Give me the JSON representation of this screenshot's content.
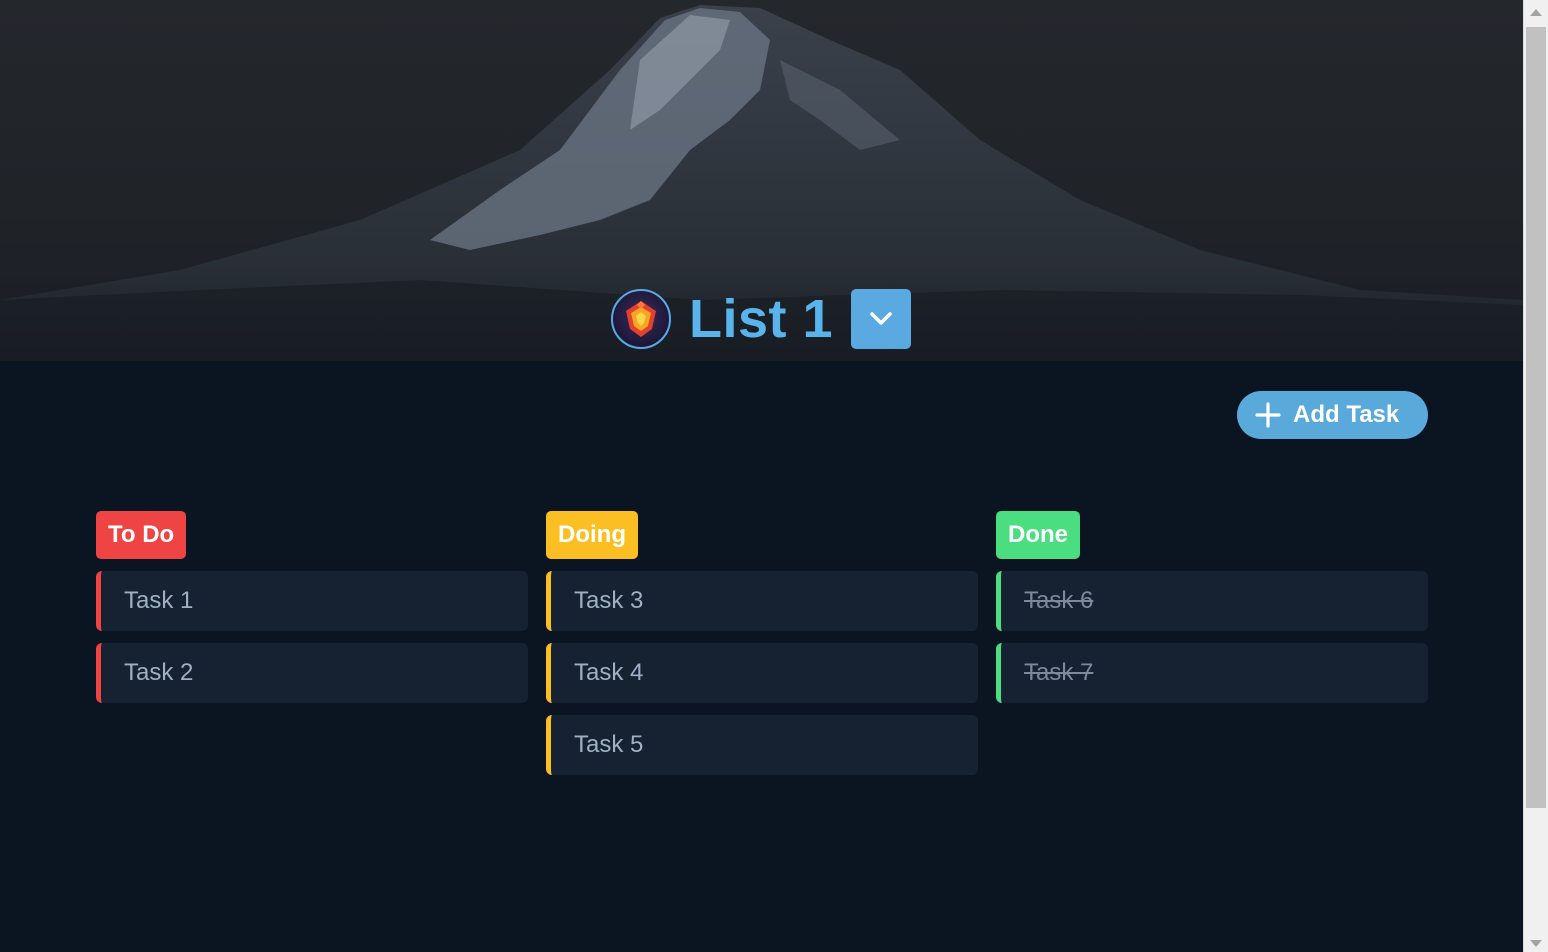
{
  "header": {
    "list_title": "List 1",
    "avatar_icon": "emblem-icon",
    "dropdown_icon": "chevron-down-icon"
  },
  "toolbar": {
    "add_task_label": "Add Task",
    "add_task_icon": "plus-icon"
  },
  "columns": [
    {
      "label": "To Do",
      "color": "#ef4444",
      "tasks": [
        "Task 1",
        "Task 2"
      ]
    },
    {
      "label": "Doing",
      "color": "#fbbf24",
      "tasks": [
        "Task 3",
        "Task 4",
        "Task 5"
      ]
    },
    {
      "label": "Done",
      "color": "#4ade80",
      "tasks": [
        "Task 6",
        "Task 7"
      ]
    }
  ],
  "colors": {
    "accent": "#5aa9e0",
    "background": "#0b1522",
    "card": "#162132"
  }
}
